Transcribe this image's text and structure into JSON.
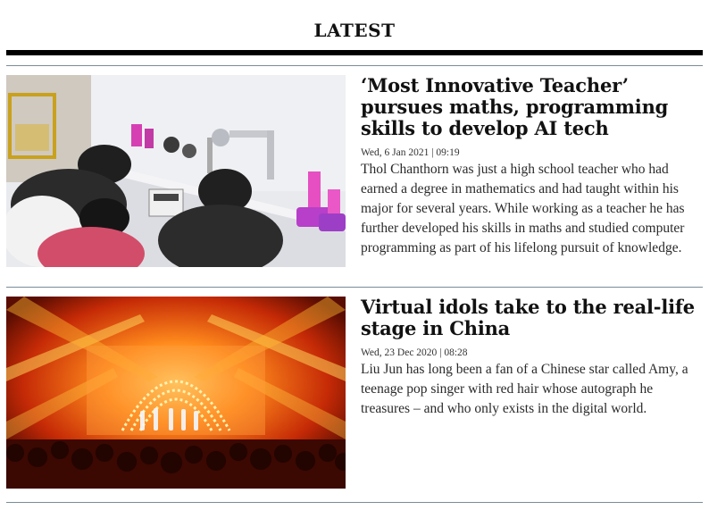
{
  "section": {
    "title": "LATEST"
  },
  "articles": [
    {
      "headline": "‘Most Innovative Teacher’ pursues maths, programming skills to develop AI tech",
      "date": "Wed, 6 Jan 2021 | 09:19",
      "summary": "Thol Chanthorn was just a high school teacher who had earned a degree in mathematics and had taught within his major for several years. While working as a teacher he has further developed his skills in maths and studied computer programming as part of his lifelong pursuit of knowledge.",
      "image": "students working with robotic arms in a lab"
    },
    {
      "headline": "Virtual idols take to the real-life stage in China",
      "date": "Wed, 23 Dec 2020 | 08:28",
      "summary": "Liu Jun has long been a fan of a Chinese star called Amy, a teenage pop singer with red hair whose autograph he treasures – and who only exists in the digital world.",
      "image": "holographic performers on a concert stage with orange lights"
    }
  ]
}
